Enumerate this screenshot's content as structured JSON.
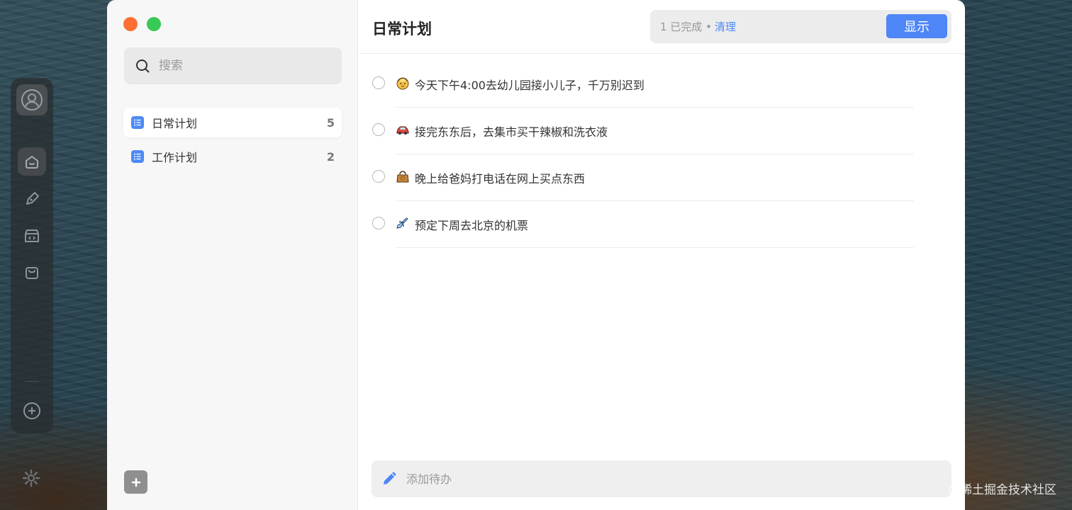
{
  "window": {
    "title": "日常计划"
  },
  "sidebar": {
    "search_placeholder": "搜索",
    "lists": [
      {
        "label": "日常计划",
        "count": "5",
        "selected": true
      },
      {
        "label": "工作计划",
        "count": "2",
        "selected": false
      }
    ]
  },
  "header": {
    "completed_text": "1 已完成 •",
    "clear_label": "清理",
    "show_label": "显示"
  },
  "todos": [
    {
      "emoji": "baby-emoji",
      "text": "今天下午4:00去幼儿园接小儿子，千万别迟到"
    },
    {
      "emoji": "car-emoji",
      "text": "接完东东后，去集市买干辣椒和洗衣液"
    },
    {
      "emoji": "handbag-emoji",
      "text": "晚上给爸妈打电话在网上买点东西"
    },
    {
      "emoji": "airplane-emoji",
      "text": "预定下周去北京的机票"
    }
  ],
  "add_todo": {
    "placeholder": "添加待办"
  },
  "watermark": "@稀土掘金技术社区",
  "colors": {
    "accent": "#4e86f7",
    "traffic_red": "#fe6f34",
    "traffic_green": "#38c956"
  }
}
